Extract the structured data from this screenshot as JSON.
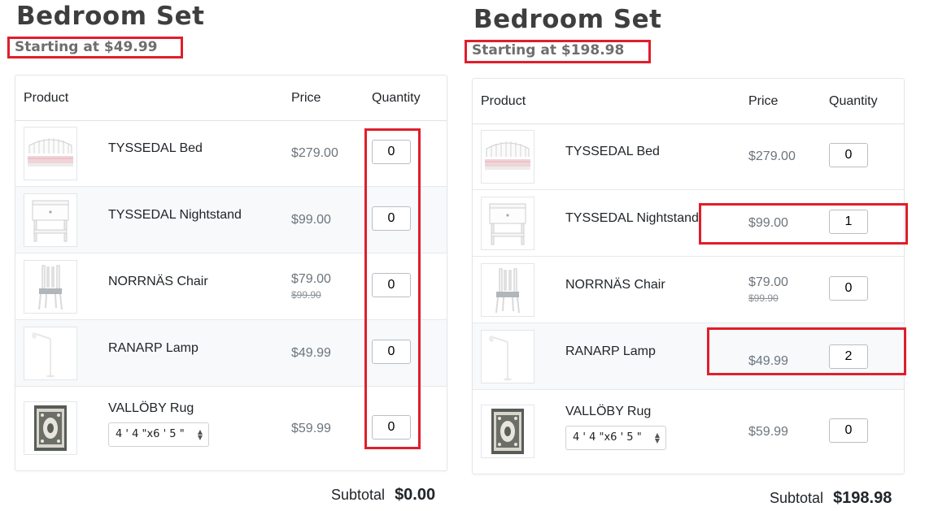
{
  "colors": {
    "highlight": "#e01e2b",
    "title": "#3e3e3e",
    "subtitle": "#6e6e6e",
    "price": "#6c757d"
  },
  "columns": {
    "product": "Product",
    "price": "Price",
    "quantity": "Quantity"
  },
  "subtotal_label": "Subtotal",
  "panels": [
    {
      "title": "Bedroom Set",
      "subtitle": "Starting at $49.99",
      "subtotal_value": "$0.00",
      "items": [
        {
          "name": "TYSSEDAL Bed",
          "price": "$279.00",
          "qty": "0",
          "icon": "bed-image"
        },
        {
          "name": "TYSSEDAL Nightstand",
          "price": "$99.00",
          "qty": "0",
          "icon": "nightstand-image"
        },
        {
          "name": "NORRNÄS Chair",
          "price": "$79.00",
          "old_price": "$99.90",
          "qty": "0",
          "icon": "chair-image"
        },
        {
          "name": "RANARP Lamp",
          "price": "$49.99",
          "qty": "0",
          "icon": "lamp-image"
        },
        {
          "name": "VALLÖBY Rug",
          "price": "$59.99",
          "qty": "0",
          "size": "4 ' 4 \"x6 ' 5 \"",
          "icon": "rug-image"
        }
      ]
    },
    {
      "title": "Bedroom Set",
      "subtitle": "Starting at $198.98",
      "subtotal_value": "$198.98",
      "items": [
        {
          "name": "TYSSEDAL Bed",
          "price": "$279.00",
          "qty": "0",
          "icon": "bed-image"
        },
        {
          "name": "TYSSEDAL Nightstand",
          "price": "$99.00",
          "qty": "1",
          "icon": "nightstand-image"
        },
        {
          "name": "NORRNÄS Chair",
          "price": "$79.00",
          "old_price": "$99.90",
          "qty": "0",
          "icon": "chair-image"
        },
        {
          "name": "RANARP Lamp",
          "price": "$49.99",
          "qty": "2",
          "icon": "lamp-image"
        },
        {
          "name": "VALLÖBY Rug",
          "price": "$59.99",
          "qty": "0",
          "size": "4 ' 4 \"x6 ' 5 \"",
          "icon": "rug-image"
        }
      ]
    }
  ]
}
